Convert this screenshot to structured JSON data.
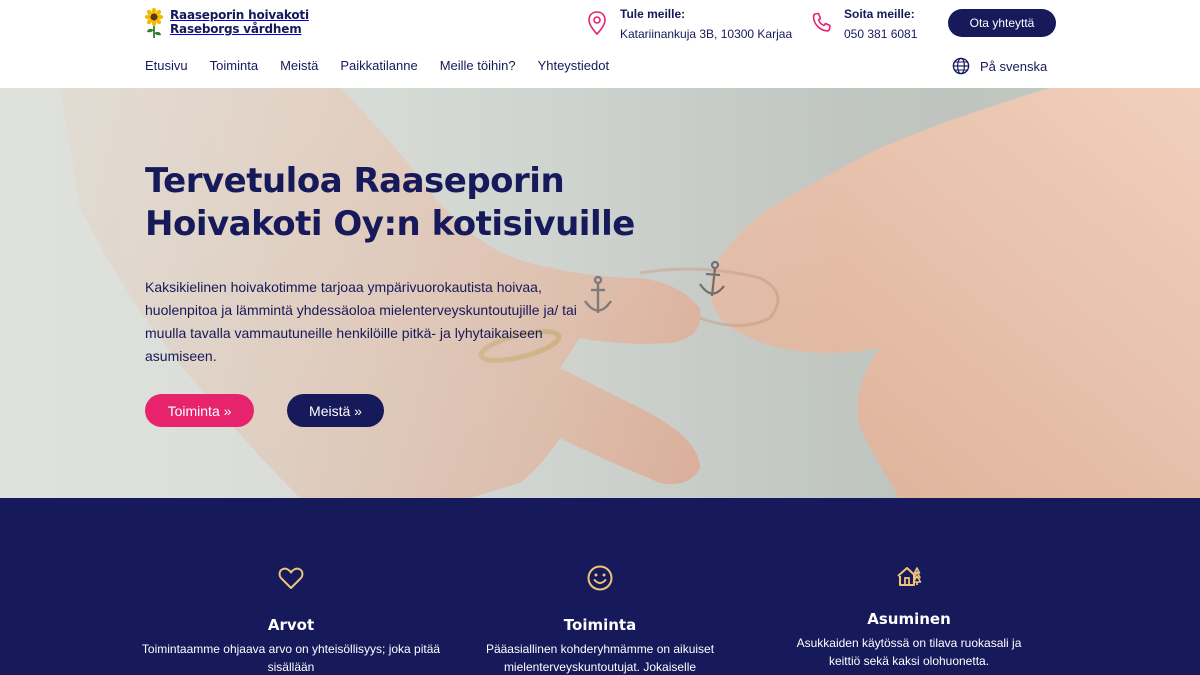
{
  "brand": {
    "line1": "Raaseporin hoivakoti",
    "line2": "Raseborgs vårdhem"
  },
  "contact": {
    "address_label": "Tule meille:",
    "address_value": "Katariinankuja 3B, 10300 Karjaa",
    "phone_label": "Soita meille:",
    "phone_value": "050 381 6081"
  },
  "header": {
    "cta_label": "Ota yhteyttä",
    "language_label": "På svenska"
  },
  "nav": [
    {
      "label": "Etusivu"
    },
    {
      "label": "Toiminta"
    },
    {
      "label": "Meistä"
    },
    {
      "label": "Paikkatilanne"
    },
    {
      "label": "Meille töihin?"
    },
    {
      "label": "Yhteystiedot"
    }
  ],
  "hero": {
    "title": "Tervetuloa Raaseporin Hoivakoti Oy:n kotisivuille",
    "text": "Kaksikielinen hoivakotimme tarjoaa ympärivuorokautista hoivaa, huolenpitoa ja lämmintä yhdessäoloa mielenterveyskuntoutujille ja/ tai muulla tavalla vammautuneille henkilöille pitkä- ja lyhytaikaiseen asumiseen.",
    "primary_button": "Toiminta »",
    "secondary_button": "Meistä »"
  },
  "features": [
    {
      "icon": "heart-icon",
      "title": "Arvot",
      "text": "Toimintaamme ohjaava arvo on yhteisöllisyys; joka pitää sisällään"
    },
    {
      "icon": "smiley-icon",
      "title": "Toiminta",
      "text": "Pääasiallinen kohderyhmämme on aikuiset mielenterveyskuntoutujat. Jokaiselle"
    },
    {
      "icon": "house-tree-icon",
      "title": "Asuminen",
      "text": "Asukkaiden käytössä on tilava ruokasali ja keittiö sekä kaksi olohuonetta."
    }
  ],
  "colors": {
    "navy": "#16195a",
    "accent_pink": "#e8236d",
    "icon_gold": "#f0c27a"
  }
}
